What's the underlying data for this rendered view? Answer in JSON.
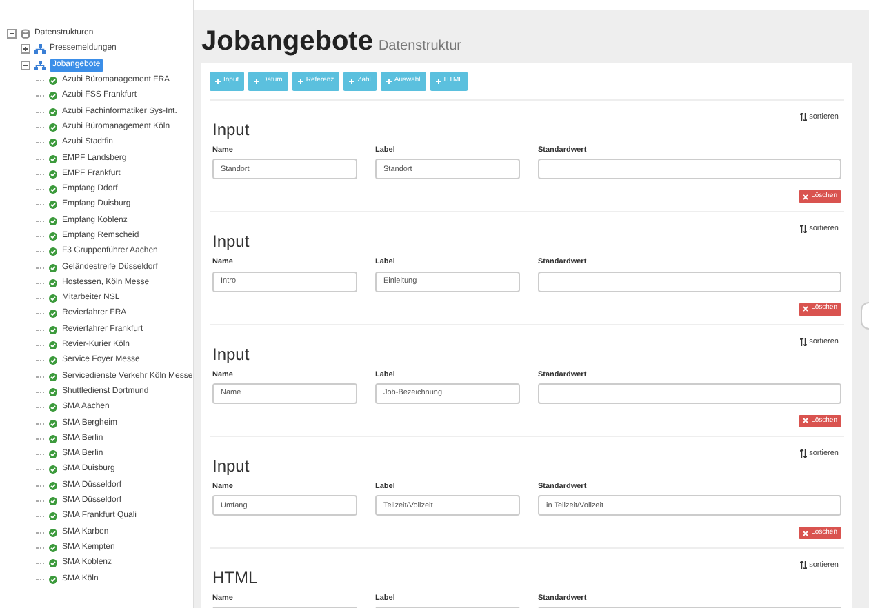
{
  "tree": {
    "label": "Datenstrukturen",
    "expanded": true,
    "children": [
      {
        "label": "Pressemeldungen",
        "expanded": false,
        "selected": false
      },
      {
        "label": "Jobangebote",
        "expanded": true,
        "selected": true,
        "children": [
          {
            "label": "Azubi Büromanagement FRA"
          },
          {
            "label": "Azubi FSS Frankfurt"
          },
          {
            "label": "Azubi Fachinformatiker Sys-Int."
          },
          {
            "label": "Azubi Büromanagement Köln"
          },
          {
            "label": "Azubi Stadtfin"
          },
          {
            "label": "EMPF Landsberg"
          },
          {
            "label": "EMPF Frankfurt"
          },
          {
            "label": "Empfang Ddorf"
          },
          {
            "label": "Empfang Duisburg"
          },
          {
            "label": "Empfang Koblenz"
          },
          {
            "label": "Empfang Remscheid"
          },
          {
            "label": "F3 Gruppenführer Aachen"
          },
          {
            "label": "Geländestreife Düsseldorf"
          },
          {
            "label": "Hostessen, Köln Messe"
          },
          {
            "label": "Mitarbeiter NSL"
          },
          {
            "label": "Revierfahrer FRA"
          },
          {
            "label": "Revierfahrer Frankfurt"
          },
          {
            "label": "Revier-Kurier Köln"
          },
          {
            "label": "Service Foyer Messe"
          },
          {
            "label": "Servicedienste Verkehr Köln Messe"
          },
          {
            "label": "Shuttledienst Dortmund"
          },
          {
            "label": "SMA Aachen"
          },
          {
            "label": "SMA Bergheim"
          },
          {
            "label": "SMA Berlin"
          },
          {
            "label": "SMA Berlin"
          },
          {
            "label": "SMA Duisburg"
          },
          {
            "label": "SMA Düsseldorf"
          },
          {
            "label": "SMA Düsseldorf"
          },
          {
            "label": "SMA Frankfurt Quali"
          },
          {
            "label": "SMA Karben"
          },
          {
            "label": "SMA Kempten"
          },
          {
            "label": "SMA Koblenz"
          },
          {
            "label": "SMA Köln"
          }
        ]
      }
    ]
  },
  "header": {
    "title": "Jobangebote",
    "subtitle": "Datenstruktur"
  },
  "add_buttons": [
    "Input",
    "Datum",
    "Referenz",
    "Zahl",
    "Auswahl",
    "HTML"
  ],
  "sections": [
    {
      "title": "Input",
      "sort": "sortieren",
      "delete": "Löschen",
      "fields": [
        {
          "label": "Name",
          "value": "Standort"
        },
        {
          "label": "Label",
          "value": "Standort"
        },
        {
          "label": "Standardwert"
        }
      ]
    },
    {
      "title": "Input",
      "sort": "sortieren",
      "delete": "Löschen",
      "fields": [
        {
          "label": "Name",
          "value": "Intro"
        },
        {
          "label": "Label",
          "value": "Einleitung"
        },
        {
          "label": "Standardwert"
        }
      ]
    },
    {
      "title": "Input",
      "sort": "sortieren",
      "delete": "Löschen",
      "fields": [
        {
          "label": "Name",
          "value": "Name"
        },
        {
          "label": "Label",
          "value": "Job-Bezeichnung"
        },
        {
          "label": "Standardwert"
        }
      ]
    },
    {
      "title": "Input",
      "sort": "sortieren",
      "delete": "Löschen",
      "fields": [
        {
          "label": "Name",
          "value": "Umfang"
        },
        {
          "label": "Label",
          "value": "Teilzeit/Vollzeit"
        },
        {
          "label": "Standardwert",
          "value": "in Teilzeit/Vollzeit"
        }
      ]
    },
    {
      "title": "HTML",
      "sort": "sortieren",
      "fields": [
        {
          "label": "Name"
        },
        {
          "label": "Label"
        },
        {
          "label": "Standardwert"
        }
      ]
    }
  ]
}
